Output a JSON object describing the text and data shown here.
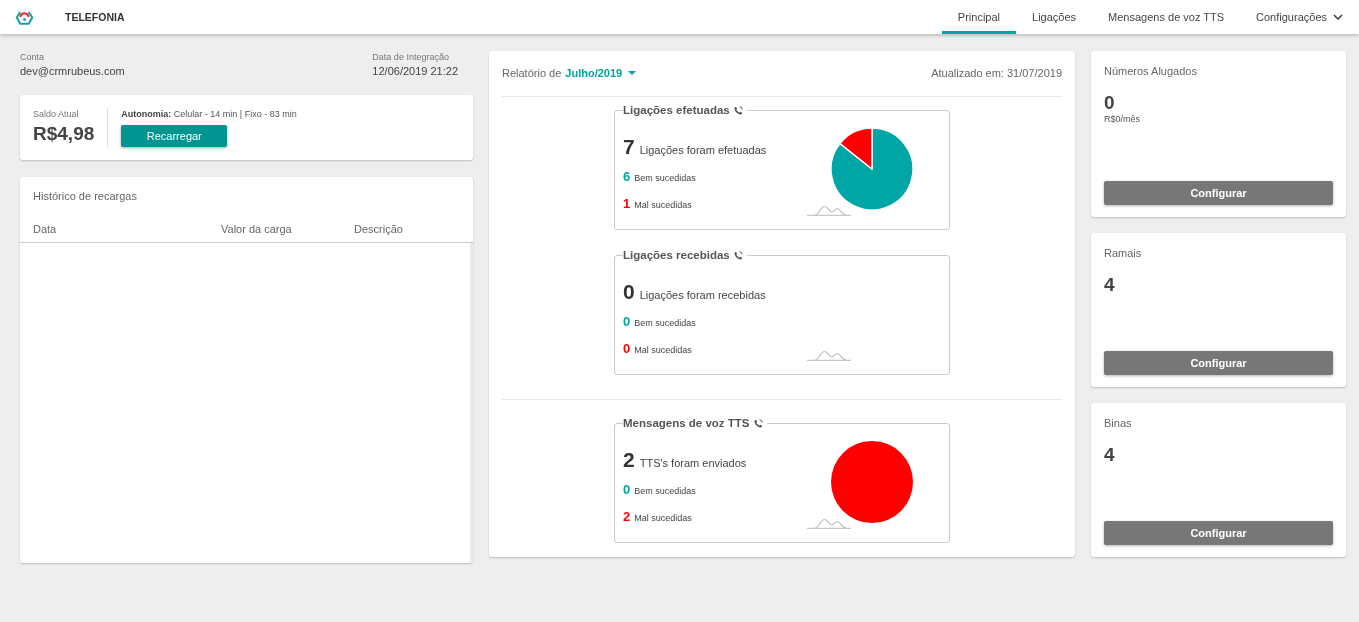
{
  "header": {
    "title": "TELEFONIA",
    "tabs": [
      {
        "label": "Principal",
        "selected": true,
        "kind": "tab"
      },
      {
        "label": "Ligações",
        "selected": false,
        "kind": "tab"
      },
      {
        "label": "Mensagens de voz TTS",
        "selected": false,
        "kind": "tab"
      },
      {
        "label": "Configurações",
        "selected": false,
        "kind": "dropdown"
      }
    ]
  },
  "account": {
    "label": "Conta",
    "email": "dev@crmrubeus.com",
    "integration_label": "Data de Integração",
    "integration_date": "12/06/2019 21:22"
  },
  "balance": {
    "label": "Saldo Atual",
    "amount": "R$4,98",
    "autonomy": "**Autonomia:** Celular - 14 min | Fixo - 83 min",
    "button": "Recarregar"
  },
  "history": {
    "title": "Histórico de recargas",
    "columns": [
      "Data",
      "Valor da carga",
      "Descrição"
    ]
  },
  "report": {
    "prefix": "Relatório de",
    "period": "Julho/2019",
    "updated": "Atualizado em: 31/07/2019",
    "groups": [
      {
        "sections": [
          {
            "title": "Ligações efetuadas",
            "total": "7",
            "total_label": "Ligações foram efetuadas",
            "stats": [
              {
                "count": "6",
                "label": "Bem sucedidas",
                "color": "#00a5a5"
              },
              {
                "count": "1",
                "label": "Mal sucedidas",
                "color": "#ff0000"
              }
            ],
            "chart_data": {
              "type": "pie",
              "values": [
                85.7,
                14.3
              ]
            }
          },
          {
            "title": "Ligações recebidas",
            "total": "0",
            "total_label": "Ligações foram recebidas",
            "stats": [
              {
                "count": "0",
                "label": "Bem sucedidas",
                "color": "#00a5a5"
              },
              {
                "count": "0",
                "label": "Mal sucedidas",
                "color": "#ff0000"
              }
            ]
          }
        ]
      },
      {
        "sections": [
          {
            "title": "Mensagens de voz TTS",
            "total": "2",
            "total_label": "TTS's foram enviados",
            "stats": [
              {
                "count": "0",
                "label": "Bem sucedidas",
                "color": "#00a5a5"
              },
              {
                "count": "2",
                "label": "Mal sucedidas",
                "color": "#ff0000"
              }
            ],
            "chart_data": {
              "type": "pie",
              "values": [
                0,
                100
              ]
            }
          }
        ]
      }
    ]
  },
  "summary_cards": [
    {
      "title": "Números Alugados",
      "value": "0",
      "subtext": "R$0/mês",
      "button": "Configurar"
    },
    {
      "title": "Ramais",
      "value": "4",
      "button": "Configurar"
    },
    {
      "title": "Binas",
      "value": "4",
      "button": "Configurar"
    }
  ]
}
